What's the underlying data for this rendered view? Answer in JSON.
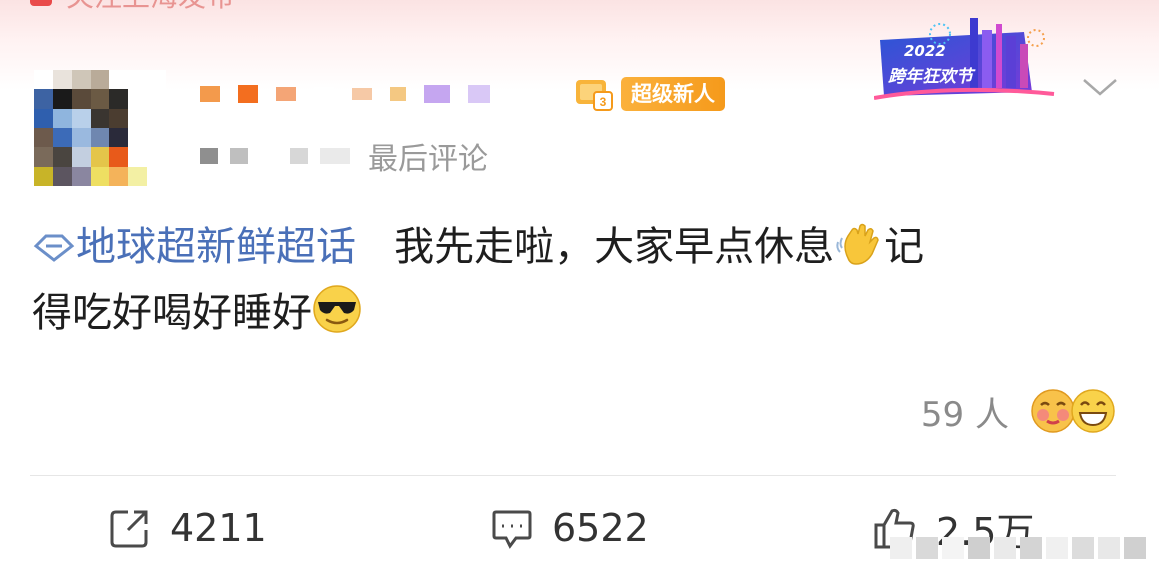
{
  "top": {
    "peek_text": "关注上海发布"
  },
  "header": {
    "badge_new": "超级新人",
    "festival_year": "2022",
    "festival_name": "跨年狂欢节",
    "meta_text": "最后评论"
  },
  "post": {
    "topic": "地球超新鲜超话",
    "text_line1": "我先走啦，大家早点休息",
    "text_line2_a": "记",
    "text_line2_b": "得吃好喝好睡好",
    "emoji_wave": "waving-hand-emoji",
    "emoji_cool": "sunglasses-emoji"
  },
  "reactions": {
    "count": "59 人",
    "faces": [
      "hug-face-icon",
      "grin-face-icon"
    ]
  },
  "actions": [
    {
      "name": "repost-button",
      "icon": "share-icon",
      "count": "4211"
    },
    {
      "name": "comment-button",
      "icon": "comment-icon",
      "count": "6522"
    },
    {
      "name": "like-button",
      "icon": "thumb-up-icon",
      "count": "2.5万"
    }
  ],
  "colors": {
    "topic": "#4a70b8",
    "badge_orange": "#f59a1b",
    "meta_gray": "#9a9a9a",
    "action_gray": "#333333"
  }
}
